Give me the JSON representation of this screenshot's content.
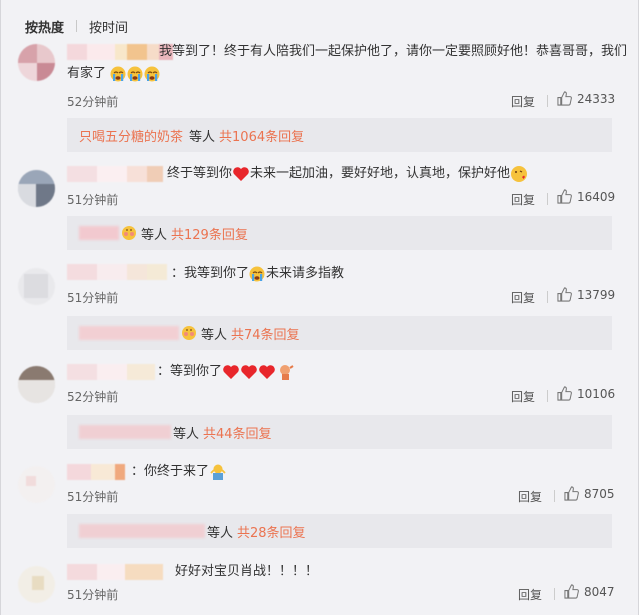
{
  "tabs": [
    {
      "label": "按热度",
      "active": true
    },
    {
      "label": "按时间",
      "active": false
    }
  ],
  "reply_label": "回复",
  "comments": [
    {
      "text": "我等到了！终于有人陪我们一起保护他了，请你一定要照顾好他！恭喜哥哥，我们",
      "text_line2": "有家了",
      "time": "52分钟前",
      "likes": "24333",
      "sub_name": "只喝五分糖的奶茶",
      "sub_who": "等人",
      "sub_count": "共1064条回复"
    },
    {
      "text": "终于等到你",
      "text_tail": "未来一起加油，要好好地，认真地，保护好他",
      "time": "51分钟前",
      "likes": "16409",
      "sub_who": "等人",
      "sub_count": "共129条回复"
    },
    {
      "text": "：我等到你了",
      "text_tail": "未来请多指教",
      "time": "51分钟前",
      "likes": "13799",
      "sub_who": "等人",
      "sub_count": "共74条回复"
    },
    {
      "text": "：等到你了",
      "time": "52分钟前",
      "likes": "10106",
      "sub_who": "等人",
      "sub_count": "共44条回复"
    },
    {
      "text": "：你终于来了",
      "time": "51分钟前",
      "likes": "8705",
      "sub_who": "等人",
      "sub_count": "共28条回复"
    },
    {
      "text": "好好对宝贝肖战！！！！",
      "time": "51分钟前",
      "likes": "8047"
    }
  ],
  "colors": {
    "accent_reply_count": "#eb7350",
    "background": "#f2f2f5",
    "sub_background": "#e8e8ec"
  },
  "icons": [
    "thumbs-up-icon",
    "crying-emoji-icon",
    "heart-emoji-icon",
    "kiss-emoji-icon",
    "shy-emoji-icon",
    "wave-emoji-icon"
  ]
}
